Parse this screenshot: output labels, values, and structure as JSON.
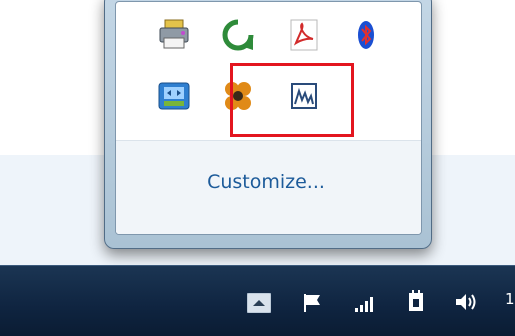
{
  "notification_flyout": {
    "customize_label": "Customize...",
    "icons": [
      {
        "name": "printer-icon"
      },
      {
        "name": "refresh-arrow-icon"
      },
      {
        "name": "pdf-icon"
      },
      {
        "name": "bluetooth-icon"
      },
      {
        "name": "remote-screen-icon"
      },
      {
        "name": "chat-flower-icon"
      },
      {
        "name": "chart-window-icon",
        "highlighted": true
      }
    ]
  },
  "taskbar": {
    "icons": [
      "show-hidden-icons-button",
      "action-center-flag-icon",
      "network-signal-icon",
      "power-plug-icon",
      "volume-icon"
    ],
    "clock_text": "1"
  },
  "colors": {
    "highlight": "#e3151f",
    "link": "#1d5b9a",
    "taskbar": "#0f2440"
  }
}
